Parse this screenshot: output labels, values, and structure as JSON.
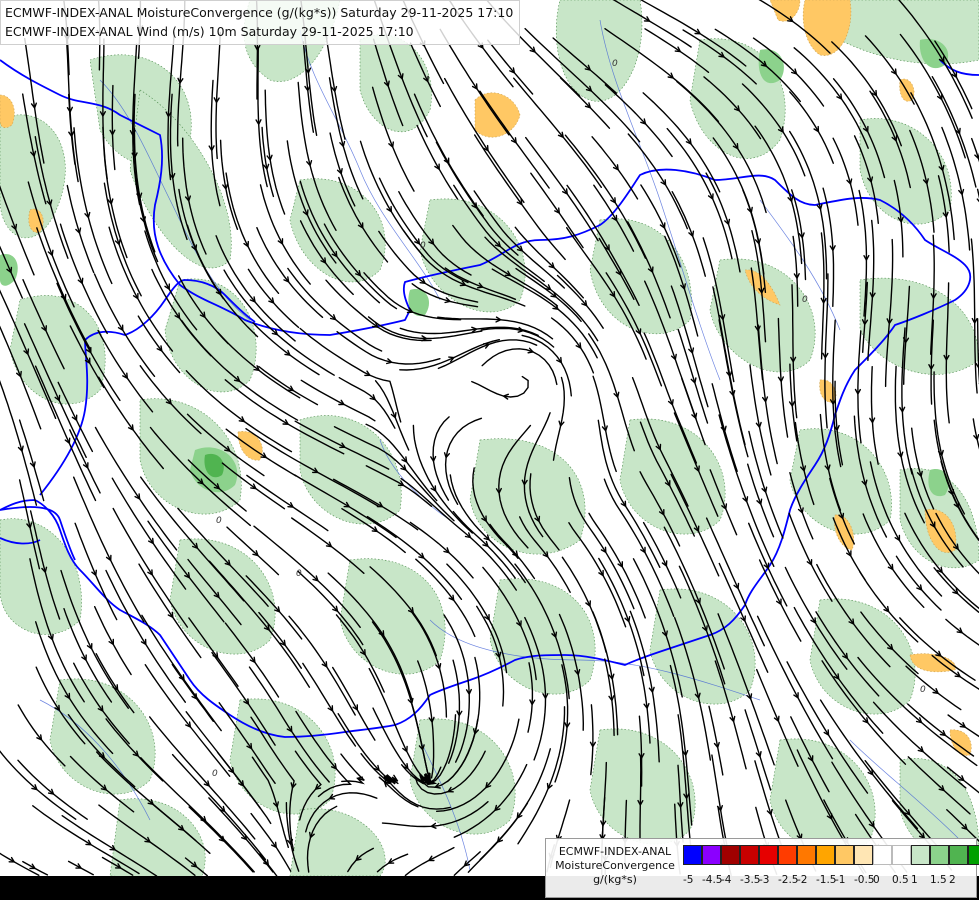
{
  "header": {
    "line1": "ECMWF-INDEX-ANAL MoistureConvergence (g/(kg*s)) Saturday 29-11-2025 17:10",
    "line2": "ECMWF-INDEX-ANAL Wind (m/s) 10m Saturday 29-11-2025 17:10"
  },
  "legend": {
    "title_line1": "ECMWF-INDEX-ANAL",
    "title_line2": "MoistureConvergence",
    "title_line3": "g/(kg*s)",
    "colors": [
      "#0000ff",
      "#8b00ff",
      "#a00000",
      "#c80000",
      "#e60000",
      "#ff3c00",
      "#ff7800",
      "#ffa500",
      "#ffc864",
      "#ffe6b4",
      "#ffffff",
      "#ffffff",
      "#c8e6c8",
      "#8cd28c",
      "#50b450",
      "#00a000"
    ],
    "ticks": [
      "-5",
      "-4.5",
      "-4",
      "-3.5",
      "-3",
      "-2.5",
      "-2",
      "-1.5",
      "-1",
      "-0.5",
      "0",
      "0.5",
      "1",
      "1.5",
      "2"
    ]
  },
  "colors": {
    "border": "#0000ff",
    "streamline": "#000000",
    "convergence_light": "#c8e6c8",
    "convergence_mid": "#8cd28c",
    "convergence_strong": "#50b450",
    "divergence_light": "#ffe6b4",
    "divergence_mid": "#ffc864"
  }
}
